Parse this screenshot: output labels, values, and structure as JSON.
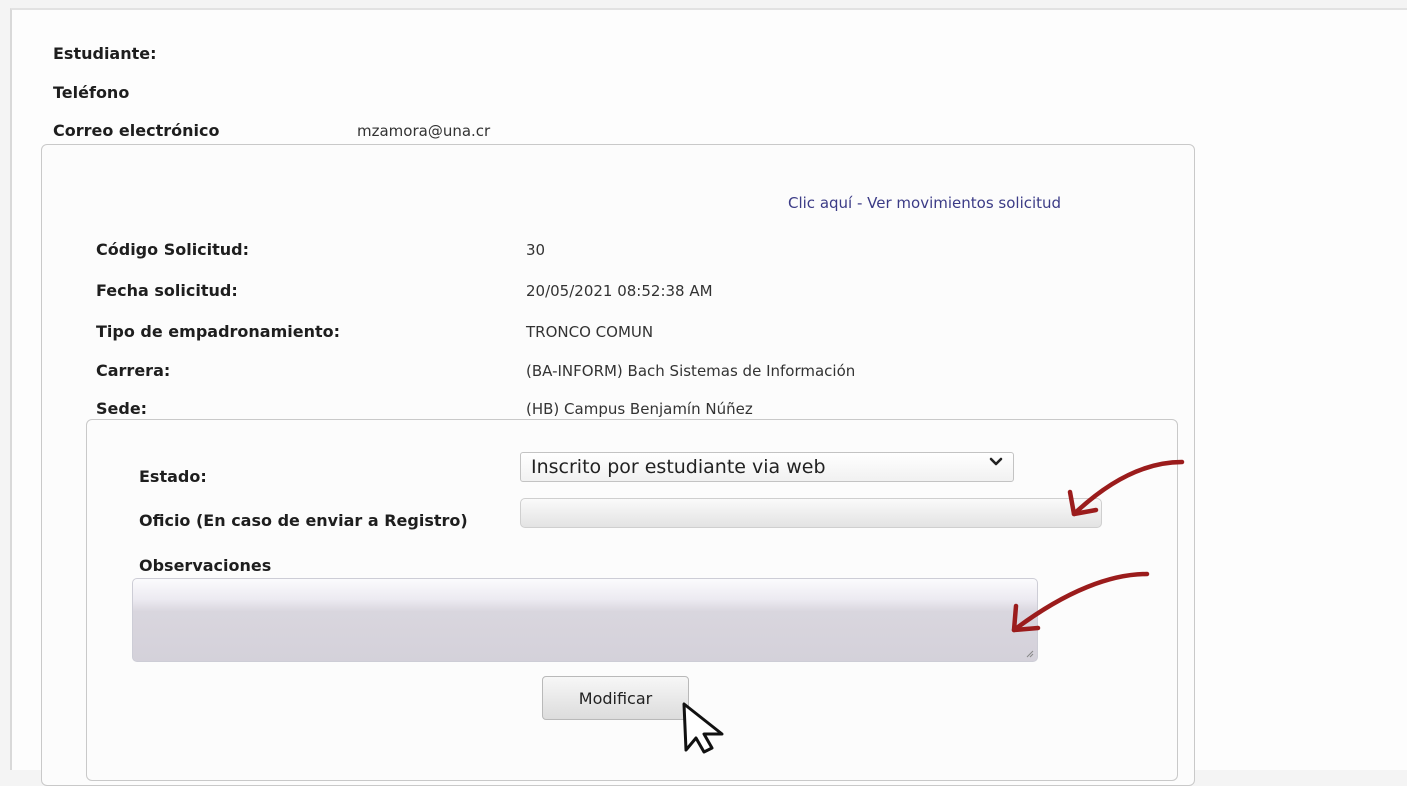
{
  "student": {
    "estudiante_label": "Estudiante:",
    "telefono_label": "Teléfono",
    "correo_label": "Correo electrónico",
    "correo_value": "mzamora@una.cr"
  },
  "solicitud": {
    "link_text": "Clic aquí - Ver movimientos solicitud",
    "fields": [
      {
        "label": "Código Solicitud:",
        "value": "30"
      },
      {
        "label": "Fecha solicitud:",
        "value": "20/05/2021 08:52:38 AM"
      },
      {
        "label": "Tipo de empadronamiento:",
        "value": "TRONCO COMUN"
      },
      {
        "label": "Carrera:",
        "value": "(BA-INFORM) Bach Sistemas de Información"
      },
      {
        "label": "Sede:",
        "value": "(HB) Campus Benjamín Núñez"
      }
    ]
  },
  "form": {
    "estado_label": "Estado:",
    "estado_selected": "Inscrito por estudiante via web",
    "oficio_label": "Oficio (En caso de enviar a Registro)",
    "oficio_value": "",
    "observaciones_label": "Observaciones",
    "observaciones_value": "",
    "submit_label": "Modificar"
  },
  "icons": {
    "select_chevron": "chevron-down-icon",
    "annotation_arrows": "red-arrow-icon",
    "cursor": "mouse-pointer-icon"
  },
  "colors": {
    "link": "#3b3b86",
    "annotation_arrow": "#9b1c1c"
  }
}
